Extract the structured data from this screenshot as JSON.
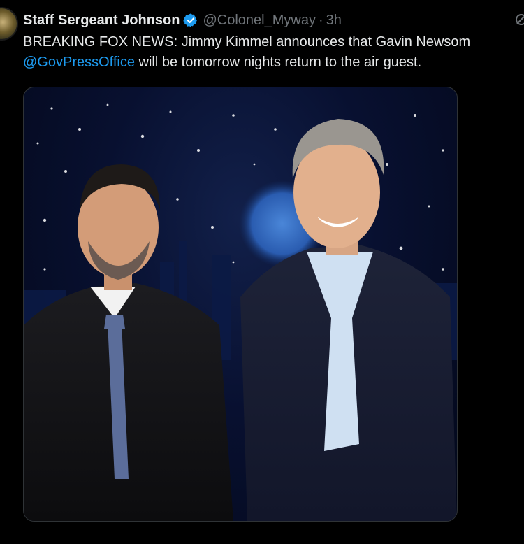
{
  "tweet": {
    "author_name": "Staff Sergeant Johnson",
    "verified": true,
    "handle": "@Colonel_Myway",
    "separator": "·",
    "time": "3h",
    "text_part1": "BREAKING FOX NEWS: Jimmy Kimmel announces that Gavin Newsom ",
    "mention": "@GovPressOffice",
    "text_part2": " will be tomorrow nights return to the air guest."
  },
  "icons": {
    "verified": "verified-badge-icon",
    "grok": "grok-icon",
    "avatar": "avatar"
  },
  "colors": {
    "background": "#000000",
    "text": "#e7e9ea",
    "muted": "#71767b",
    "link": "#1d9bf0",
    "verified": "#1d9bf0"
  }
}
